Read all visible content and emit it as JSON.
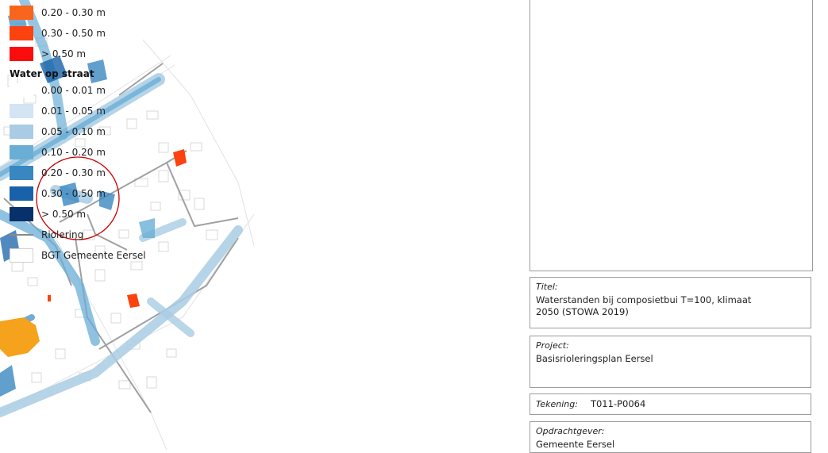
{
  "legend": {
    "top_items": [
      {
        "label": "0.20 - 0.30 m",
        "color": "#f9651c"
      },
      {
        "label": "0.30 - 0.50 m",
        "color": "#fb420f"
      },
      {
        "label": "> 0.50 m",
        "color": "#fb0d0d"
      }
    ],
    "water_heading": "Water op straat",
    "water_items": [
      {
        "label": "0.00 - 0.01 m",
        "color": "#ffffff"
      },
      {
        "label": "0.01 - 0.05 m",
        "color": "#d3e4f3"
      },
      {
        "label": "0.05 - 0.10 m",
        "color": "#a9cce4"
      },
      {
        "label": "0.10 - 0.20 m",
        "color": "#6aaed6"
      },
      {
        "label": "0.20 - 0.30 m",
        "color": "#3987c0"
      },
      {
        "label": "0.30 - 0.50 m",
        "color": "#1762aa"
      },
      {
        "label": "> 0.50 m",
        "color": "#08306b"
      }
    ],
    "riolering_label": "Riolering",
    "bgt_label": "BGT Gemeente Eersel"
  },
  "titel": {
    "label": "Titel:",
    "value": "Waterstanden bij composietbui T=100, klimaat 2050 (STOWA 2019)"
  },
  "project": {
    "label": "Project:",
    "value": "Basisrioleringsplan Eersel"
  },
  "tekening": {
    "label": "Tekening:",
    "value": "T011-P0064"
  },
  "opdrachtgever": {
    "label": "Opdrachtgever:",
    "value": "Gemeente Eersel"
  }
}
